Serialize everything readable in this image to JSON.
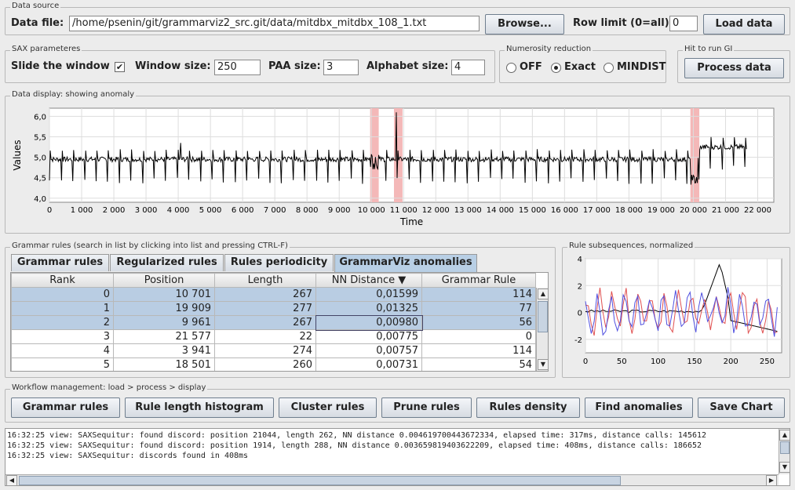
{
  "data_source": {
    "title": "Data source",
    "file_label": "Data file:",
    "file_path": "/home/psenin/git/grammarviz2_src.git/data/mitdbx_mitdbx_108_1.txt",
    "browse": "Browse...",
    "row_limit_label": "Row limit (0=all):",
    "row_limit": "0",
    "load": "Load data"
  },
  "sax": {
    "title": "SAX parameteres",
    "slide_label": "Slide the window",
    "slide_check": "✔",
    "window_label": "Window size:",
    "window": "250",
    "paa_label": "PAA size:",
    "paa": "3",
    "alphabet_label": "Alphabet size:",
    "alphabet": "4"
  },
  "numerosity": {
    "title": "Numerosity reduction",
    "options": [
      "OFF",
      "Exact",
      "MINDIST"
    ],
    "selected": "Exact"
  },
  "gi": {
    "title": "Hit to run GI",
    "process": "Process data"
  },
  "display": {
    "title": "Data display: showing anomaly",
    "xlabel": "Time",
    "ylabel": "Values"
  },
  "grammar": {
    "title": "Grammar rules (search in list by clicking into list and pressing CTRL-F)",
    "tabs": [
      "Grammar rules",
      "Regularized rules",
      "Rules periodicity",
      "GrammarViz anomalies"
    ],
    "columns": [
      "Rank",
      "Position",
      "Length",
      "NN Distance ▼",
      "Grammar Rule"
    ],
    "rows": [
      [
        "0",
        "10 701",
        "267",
        "0,01599",
        "114"
      ],
      [
        "1",
        "19 909",
        "277",
        "0,01325",
        "77"
      ],
      [
        "2",
        "9 961",
        "267",
        "0,00980",
        "56"
      ],
      [
        "3",
        "21 577",
        "22",
        "0,00775",
        "0"
      ],
      [
        "4",
        "3 941",
        "274",
        "0,00757",
        "114"
      ],
      [
        "5",
        "18 501",
        "260",
        "0,00731",
        "54"
      ]
    ]
  },
  "subseq": {
    "title": "Rule subsequences, normalized"
  },
  "workflow": {
    "title": "Workflow management: load > process > display",
    "buttons": [
      "Grammar rules",
      "Rule length histogram",
      "Cluster rules",
      "Prune rules",
      "Rules density",
      "Find anomalies",
      "Save Chart"
    ]
  },
  "log": [
    "16:32:25 view: SAXSequitur: found discord: position 21044, length 262, NN distance 0.004619700443672334, elapsed time: 317ms, distance calls: 145612",
    "16:32:25 view: SAXSequitur: found discord: position 1914, length 288, NN distance 0.003659819403622209, elapsed time: 408ms, distance calls: 186652",
    "16:32:25 view: SAXSequitur: discords found in 408ms"
  ],
  "chart_data": [
    {
      "type": "line",
      "title": "",
      "xlabel": "Time",
      "ylabel": "Values",
      "xlim": [
        0,
        22500
      ],
      "ylim": [
        3.9,
        6.2
      ],
      "xticks": [
        "0",
        "1 000",
        "2 000",
        "3 000",
        "4 000",
        "5 000",
        "6 000",
        "7 000",
        "8 000",
        "9 000",
        "10 000",
        "11 000",
        "12 000",
        "13 000",
        "14 000",
        "15 000",
        "16 000",
        "17 000",
        "18 000",
        "19 000",
        "20 000",
        "21 000",
        "22 000"
      ],
      "yticks": [
        "4,0",
        "4,5",
        "5,0",
        "5,5",
        "6,0"
      ],
      "anomalies": [
        [
          9961,
          10228
        ],
        [
          10701,
          10968
        ],
        [
          19909,
          20186
        ]
      ],
      "series": [
        {
          "values_summary": "ECG-like signal ~5.0 baseline with periodic dips to ~4.2, spike to ~6.1 near 11000, rise to ~5.3 after 20000"
        }
      ]
    },
    {
      "type": "line",
      "title": "",
      "xlim": [
        0,
        270
      ],
      "ylim": [
        -3,
        4
      ],
      "xticks": [
        "0",
        "50",
        "100",
        "150",
        "200",
        "250"
      ],
      "yticks": [
        "-2",
        "0",
        "2",
        "4"
      ],
      "series": [
        {
          "color": "#000000",
          "values_summary": "flat ~0 then peak ~3.8 at 180"
        },
        {
          "color": "#e05050",
          "values_summary": "oscillating"
        },
        {
          "color": "#5050e0",
          "values_summary": "oscillating"
        }
      ]
    }
  ]
}
